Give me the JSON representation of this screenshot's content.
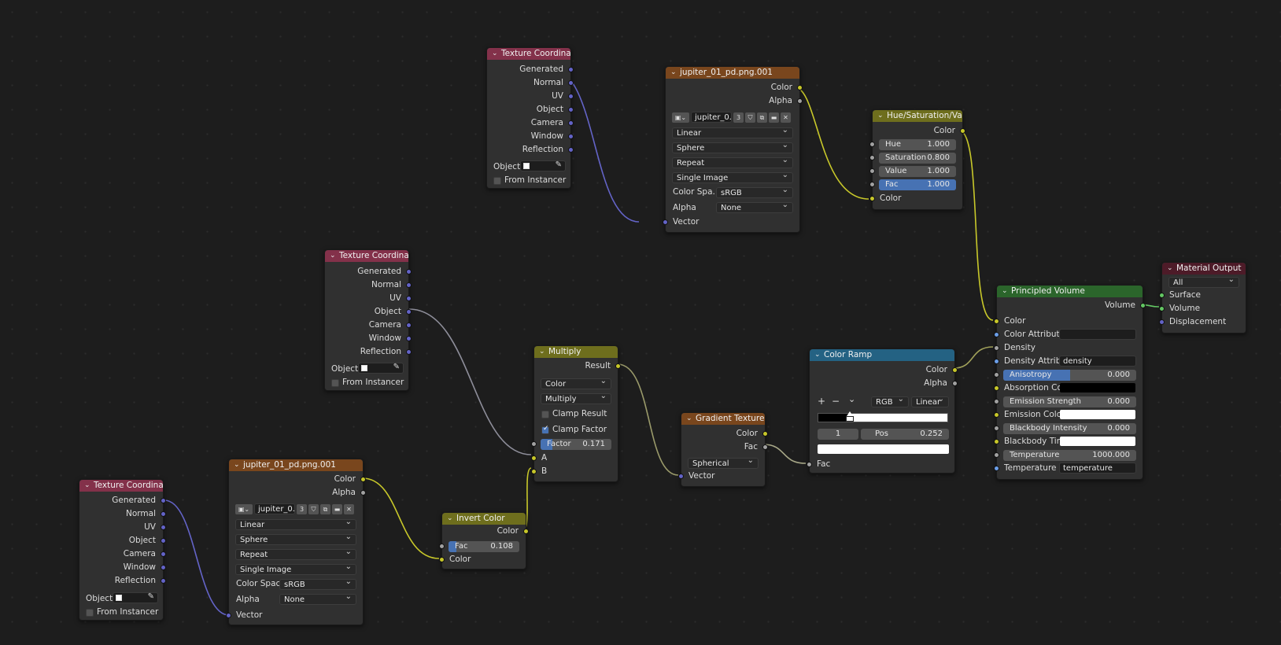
{
  "tex_coord": {
    "title": "Texture Coordinate",
    "outputs": [
      "Generated",
      "Normal",
      "UV",
      "Object",
      "Camera",
      "Window",
      "Reflection"
    ],
    "object_label": "Object:",
    "from_instancer": "From Instancer"
  },
  "image_top": {
    "title": "jupiter_01_pd.png.001",
    "out_color": "Color",
    "out_alpha": "Alpha",
    "image_name": "jupiter_0...",
    "users": "3",
    "interpolation": "Linear",
    "projection": "Sphere",
    "extension": "Repeat",
    "source": "Single Image",
    "color_space_label": "Color Spa...",
    "color_space": "sRGB",
    "alpha_label": "Alpha",
    "alpha": "None",
    "in_vector": "Vector"
  },
  "image_bottom": {
    "title": "jupiter_01_pd.png.001",
    "out_color": "Color",
    "out_alpha": "Alpha",
    "image_name": "jupiter_0...",
    "users": "3",
    "interpolation": "Linear",
    "projection": "Sphere",
    "extension": "Repeat",
    "source": "Single Image",
    "color_space_label": "Color Space",
    "color_space": "sRGB",
    "alpha_label": "Alpha",
    "alpha": "None",
    "in_vector": "Vector"
  },
  "hsv": {
    "title": "Hue/Saturation/Value",
    "out_color": "Color",
    "hue_label": "Hue",
    "hue": "1.000",
    "sat_label": "Saturation",
    "sat": "0.800",
    "val_label": "Value",
    "val": "1.000",
    "fac_label": "Fac",
    "fac": "1.000",
    "in_color": "Color"
  },
  "multiply": {
    "title": "Multiply",
    "out_result": "Result",
    "data_type": "Color",
    "blend": "Multiply",
    "clamp_result": "Clamp Result",
    "clamp_factor": "Clamp Factor",
    "factor_label": "Factor",
    "factor": "0.171",
    "factor_fraction": 0.171,
    "in_a": "A",
    "in_b": "B"
  },
  "invert": {
    "title": "Invert Color",
    "out_color": "Color",
    "fac_label": "Fac",
    "fac": "0.108",
    "fac_fraction": 0.108,
    "in_color": "Color"
  },
  "gradient": {
    "title": "Gradient Texture",
    "out_color": "Color",
    "out_fac": "Fac",
    "type": "Spherical",
    "in_vector": "Vector"
  },
  "ramp": {
    "title": "Color Ramp",
    "out_color": "Color",
    "out_alpha": "Alpha",
    "plus": "+",
    "minus": "−",
    "menu": "⌄",
    "color_mode": "RGB",
    "interp": "Linear",
    "index": "1",
    "pos_label": "Pos",
    "pos": "0.252",
    "pos_fraction": 0.252,
    "in_fac": "Fac"
  },
  "volume": {
    "title": "Principled Volume",
    "out_volume": "Volume",
    "color": "Color",
    "color_attr": "Color Attribute",
    "density": "Density",
    "density_attr_label": "Density Attrib...",
    "density_attr": "density",
    "aniso_label": "Anisotropy",
    "aniso": "0.000",
    "absorption_label": "Absorption Co...",
    "emission_strength_label": "Emission Strength",
    "emission_strength": "0.000",
    "emission_color_label": "Emission Color",
    "blackbody_label": "Blackbody Intensity",
    "blackbody": "0.000",
    "blackbody_tint_label": "Blackbody Tint",
    "temp_label": "Temperature",
    "temp": "1000.000",
    "temp_attr_label": "Temperature ...",
    "temp_attr": "temperature"
  },
  "output": {
    "title": "Material Output",
    "target": "All",
    "surface": "Surface",
    "volume": "Volume",
    "displacement": "Displacement"
  },
  "colors": {
    "vector_socket": "#6363c7",
    "color_socket": "#c7c729",
    "value_socket": "#a1a1a1",
    "shader_socket": "#63c763",
    "accent": "#4772b3"
  }
}
